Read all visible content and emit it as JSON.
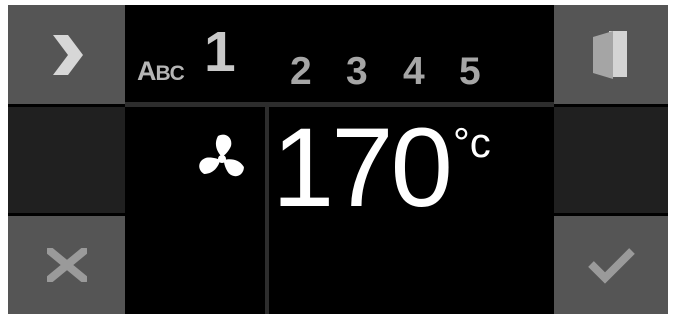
{
  "header": {
    "category_label_cap": "A",
    "category_label_rest": "BC",
    "active_slot": "1",
    "slots": [
      "2",
      "3",
      "4",
      "5"
    ]
  },
  "display": {
    "temperature": "170",
    "unit": "°c",
    "mode_icon": "fan-icon"
  },
  "buttons": {
    "next": "chevron-right-icon",
    "exit": "door-exit-icon",
    "cancel": "close-icon",
    "confirm": "checkmark-icon"
  },
  "colors": {
    "background": "#000000",
    "button_light": "#555555",
    "button_dark": "#202020",
    "icon_light": "#d2d2d2",
    "icon_dim": "#9a9a9a",
    "text_white": "#ffffff"
  }
}
